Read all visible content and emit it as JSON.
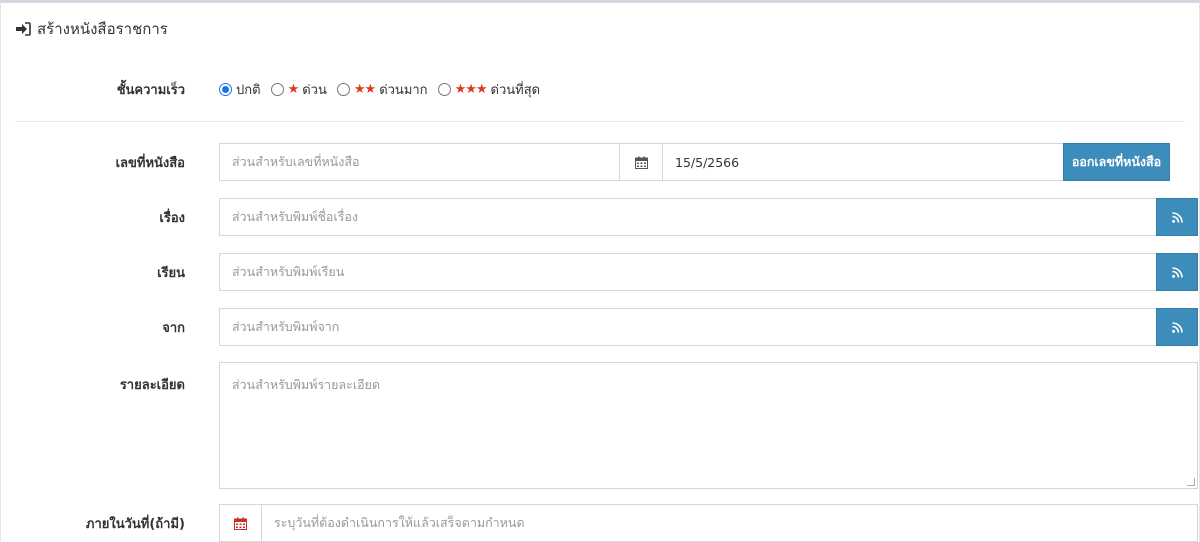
{
  "header": {
    "title": "สร้างหนังสือราชการ",
    "icon": "sign-in-icon"
  },
  "urgency": {
    "label": "ชั้นความเร็ว",
    "options": [
      {
        "label": "ปกติ",
        "stars": "",
        "selected": true
      },
      {
        "label": "ด่วน",
        "stars": "★",
        "selected": false
      },
      {
        "label": "ด่วนมาก",
        "stars": "★★",
        "selected": false
      },
      {
        "label": "ด่วนที่สุด",
        "stars": "★★★",
        "selected": false
      }
    ]
  },
  "doc_number": {
    "label": "เลขที่หนังสือ",
    "placeholder": "ส่วนสำหรับเลขที่หนังสือ",
    "date_value": "15/5/2566",
    "button_label": "ออกเลขที่หนังสือ"
  },
  "subject": {
    "label": "เรื่อง",
    "placeholder": "ส่วนสำหรับพิมพ์ชื่อเรื่อง"
  },
  "to": {
    "label": "เรียน",
    "placeholder": "ส่วนสำหรับพิมพ์เรียน"
  },
  "from": {
    "label": "จาก",
    "placeholder": "ส่วนสำหรับพิมพ์จาก"
  },
  "details": {
    "label": "รายละเอียด",
    "placeholder": "ส่วนสำหรับพิมพ์รายละเอียด"
  },
  "due_date": {
    "label": "ภายในวันที่(ถ้ามี)",
    "placeholder": "ระบุวันที่ต้องดำเนินการให้แล้วเสร็จตามกำหนด"
  },
  "colors": {
    "accent": "#3c8dbc",
    "star": "#e03a1e",
    "radio": "#1a73e8",
    "calendar_red": "#c9302c"
  }
}
